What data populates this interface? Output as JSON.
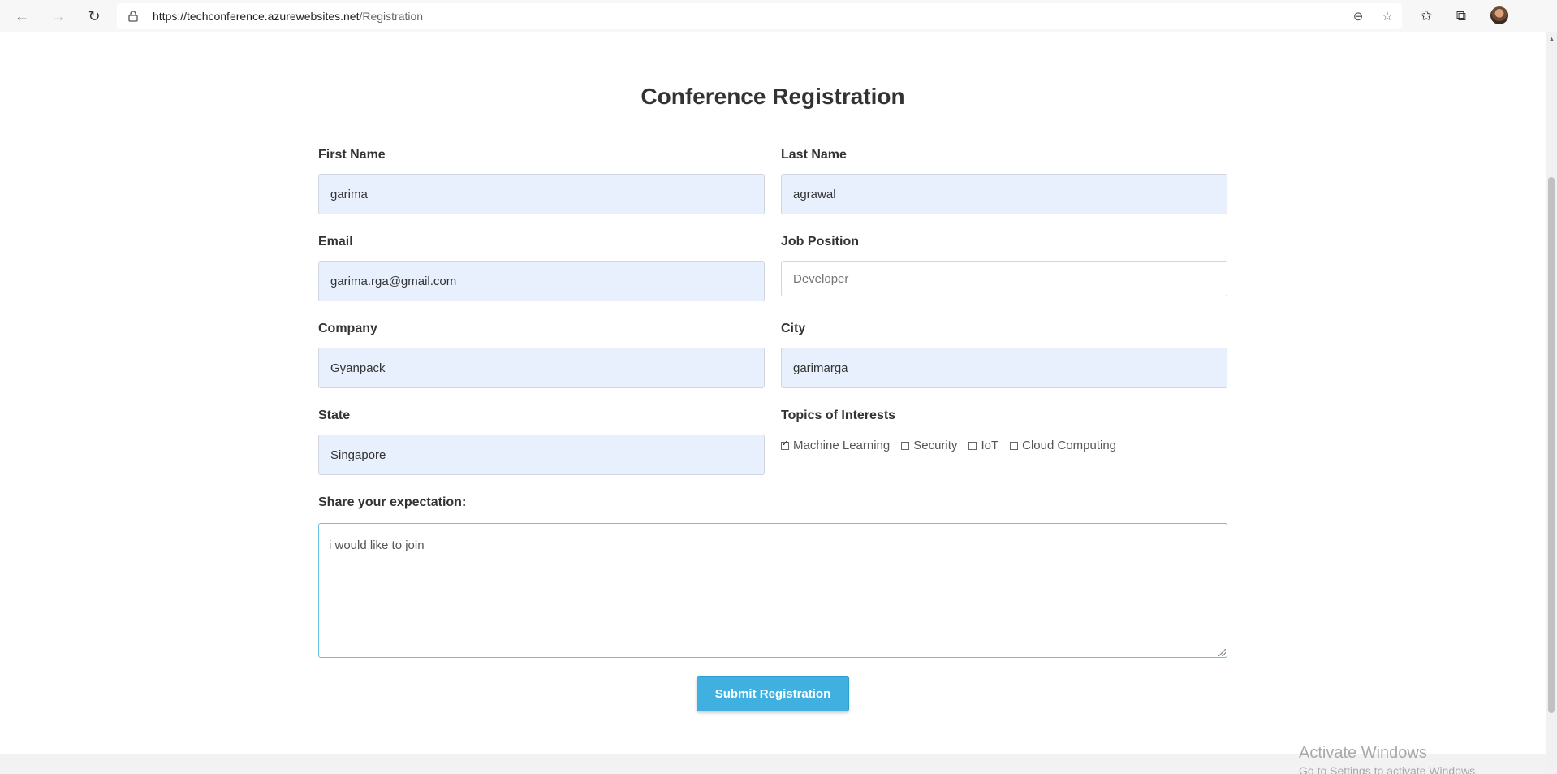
{
  "browser": {
    "url_host": "https://techconference.azurewebsites.net",
    "url_path": "/Registration"
  },
  "page": {
    "title": "Conference Registration"
  },
  "form": {
    "first_name": {
      "label": "First Name",
      "value": "garima"
    },
    "last_name": {
      "label": "Last Name",
      "value": "agrawal"
    },
    "email": {
      "label": "Email",
      "value": "garima.rga@gmail.com"
    },
    "job_position": {
      "label": "Job Position",
      "value": "",
      "placeholder": "Developer"
    },
    "company": {
      "label": "Company",
      "value": "Gyanpack"
    },
    "city": {
      "label": "City",
      "value": "garimarga"
    },
    "state": {
      "label": "State",
      "value": "Singapore"
    },
    "topics": {
      "label": "Topics of Interests",
      "options": [
        {
          "label": "Machine Learning",
          "checked": true
        },
        {
          "label": "Security",
          "checked": false
        },
        {
          "label": "IoT",
          "checked": false
        },
        {
          "label": "Cloud Computing",
          "checked": false
        }
      ]
    },
    "expectation": {
      "label": "Share your expectation:",
      "value": "i would like to join"
    },
    "submit_label": "Submit Registration"
  },
  "watermark": {
    "line1": "Activate Windows",
    "line2": "Go to Settings to activate Windows."
  }
}
